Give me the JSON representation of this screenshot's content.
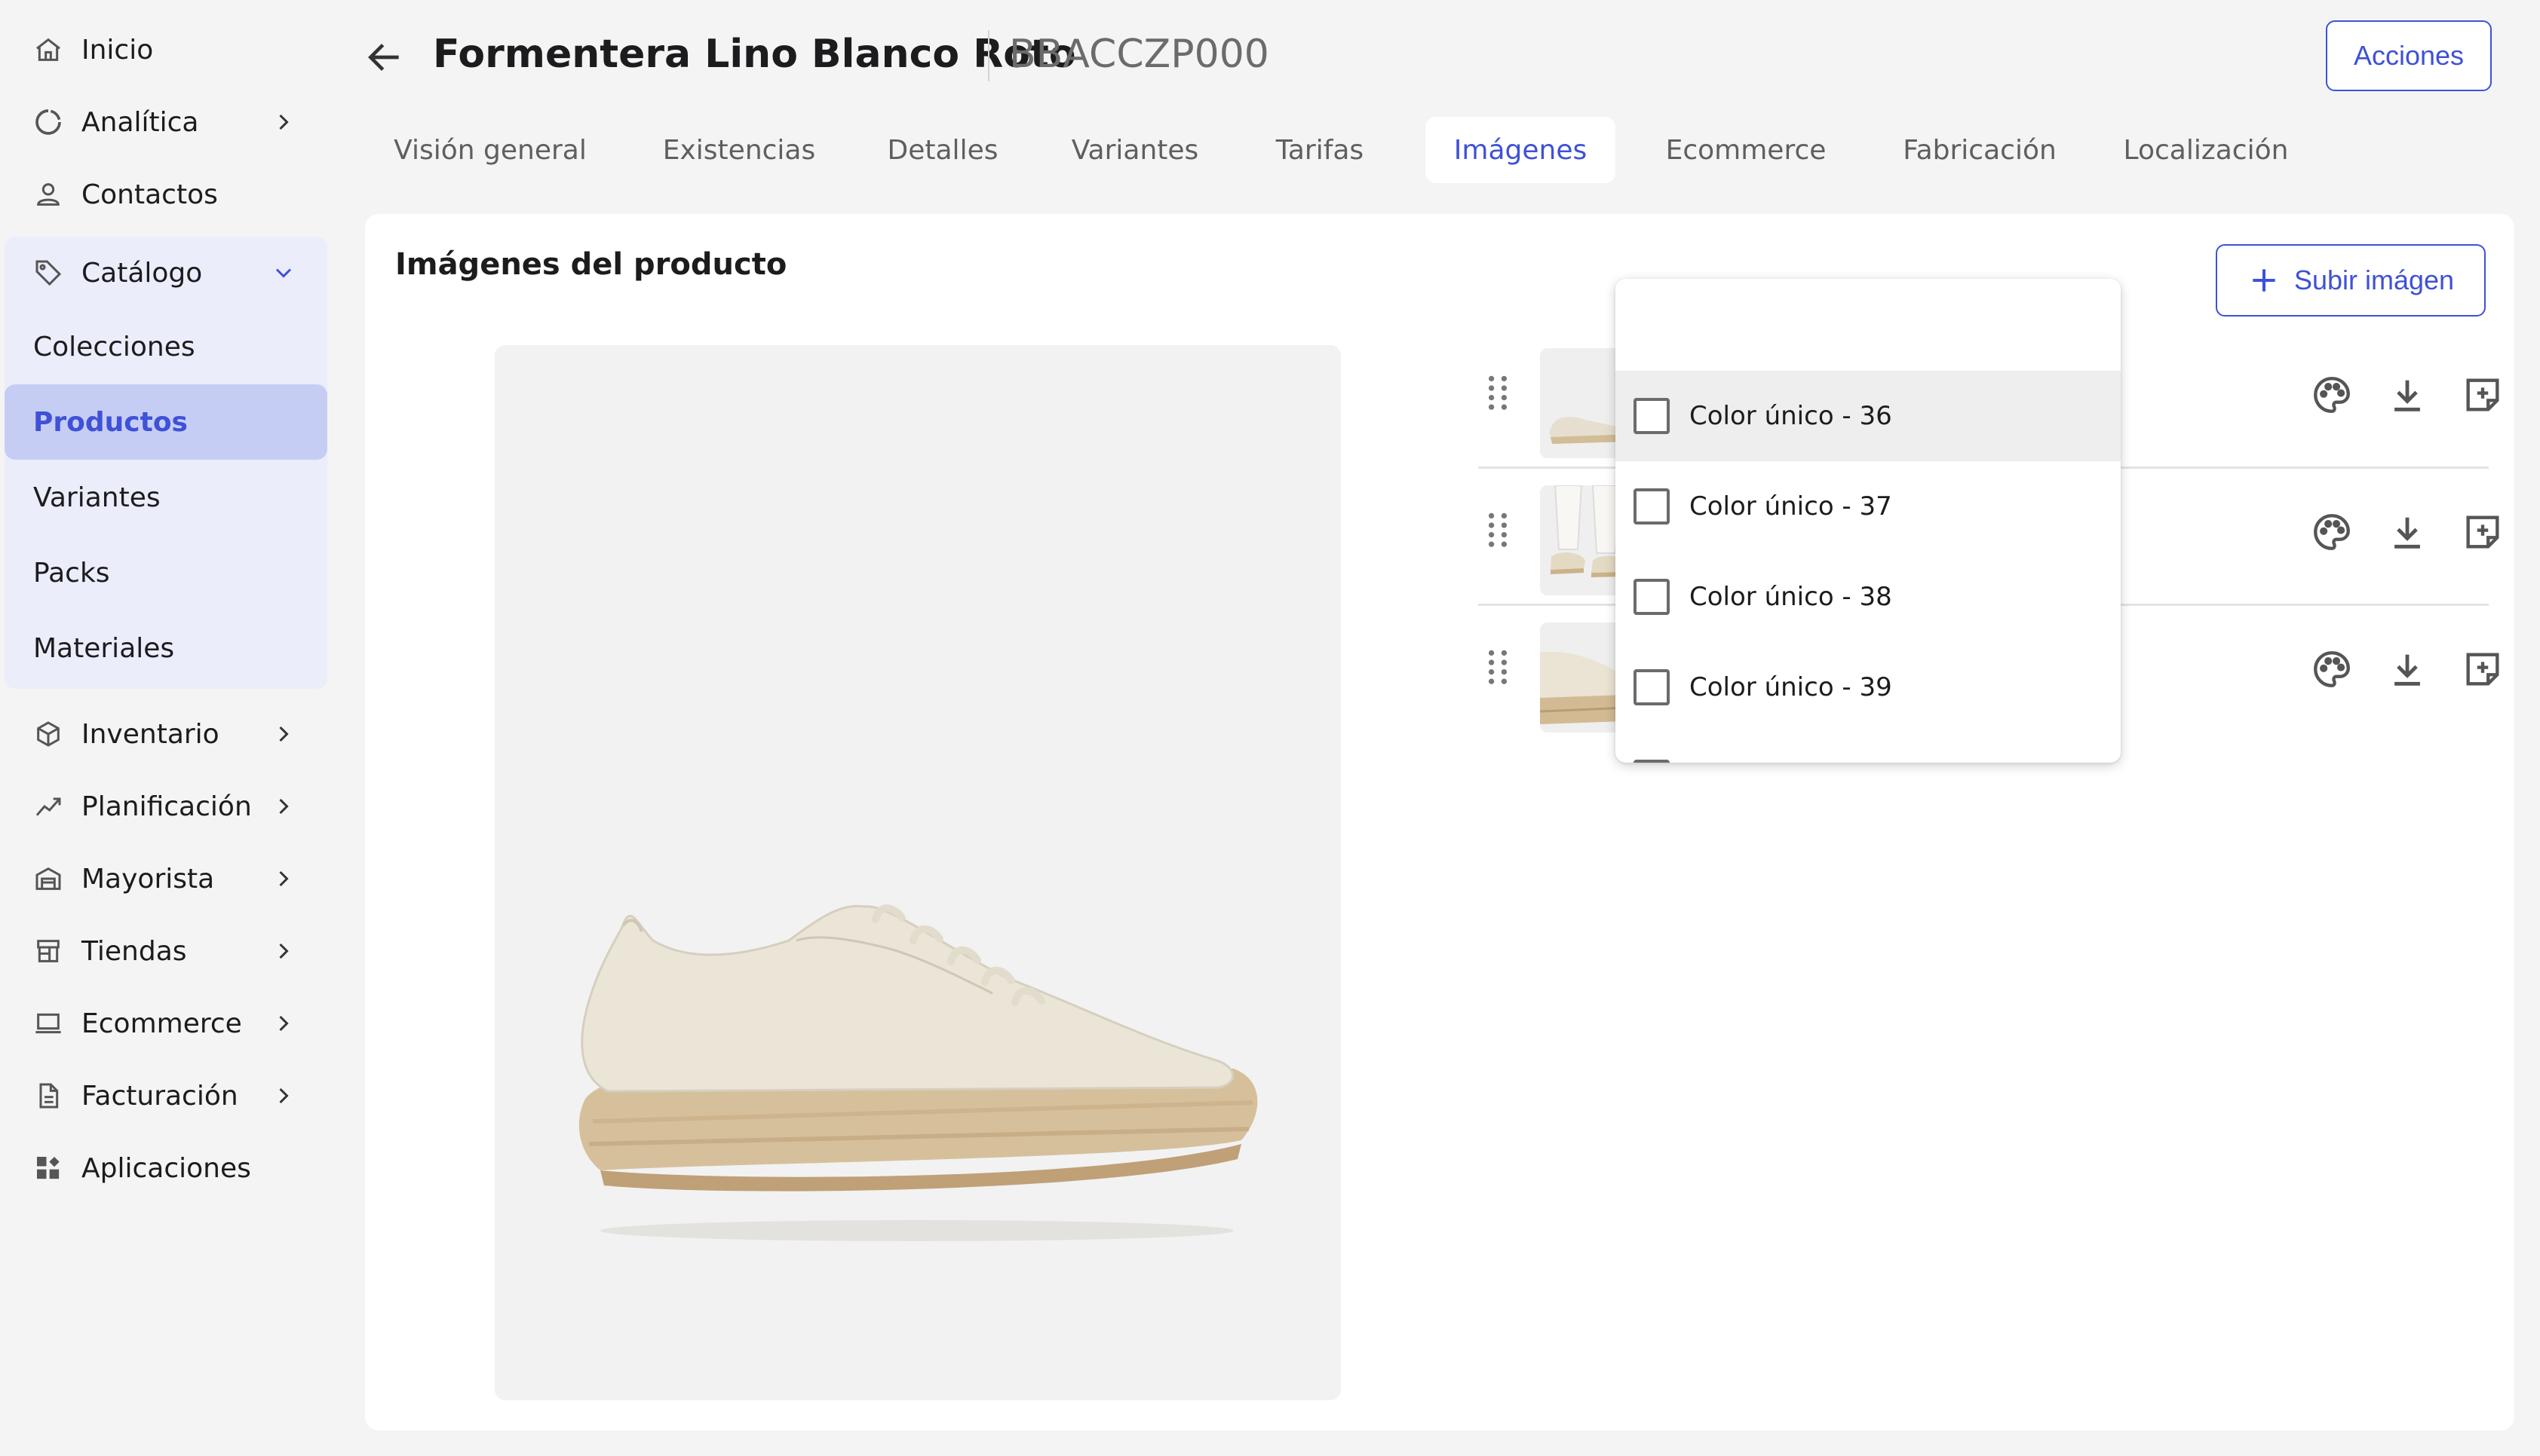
{
  "sidebar": {
    "items_top": [
      {
        "label": "Inicio",
        "icon": "home-icon"
      },
      {
        "label": "Analítica",
        "icon": "analytics-icon"
      },
      {
        "label": "Contactos",
        "icon": "person-icon"
      }
    ],
    "catalog": {
      "label": "Catálogo",
      "icon": "tag-icon",
      "children": [
        "Colecciones",
        "Productos",
        "Variantes",
        "Packs",
        "Materiales"
      ],
      "active": "Productos"
    },
    "items_bottom": [
      {
        "label": "Inventario",
        "icon": "box-icon"
      },
      {
        "label": "Planificación",
        "icon": "trend-icon"
      },
      {
        "label": "Mayorista",
        "icon": "warehouse-icon"
      },
      {
        "label": "Tiendas",
        "icon": "store-icon"
      },
      {
        "label": "Ecommerce",
        "icon": "laptop-icon"
      },
      {
        "label": "Facturación",
        "icon": "invoice-icon"
      },
      {
        "label": "Aplicaciones",
        "icon": "apps-icon"
      }
    ]
  },
  "header": {
    "title": "Formentera Lino Blanco Roto",
    "sku": "BBACCZP000",
    "actions_label": "Acciones"
  },
  "tabs": [
    "Visión general",
    "Existencias",
    "Detalles",
    "Variantes",
    "Tarifas",
    "Imágenes",
    "Ecommerce",
    "Fabricación",
    "Localización"
  ],
  "active_tab": "Imágenes",
  "images_section": {
    "title": "Imágenes del producto",
    "upload_label": "Subir imágen",
    "rows": 3
  },
  "variant_dropdown": {
    "options": [
      "Color único - 36",
      "Color único - 37",
      "Color único - 38",
      "Color único - 39"
    ],
    "highlighted": "Color único - 36"
  },
  "colors": {
    "accent": "#3f51d6",
    "active_bg": "#c6cdf5",
    "group_bg": "#ebedfb",
    "page_bg": "#f4f4f4"
  }
}
